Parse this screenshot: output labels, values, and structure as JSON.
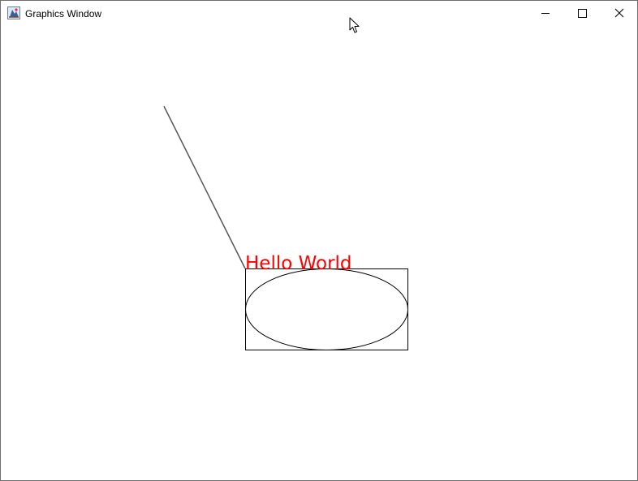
{
  "window": {
    "title": "Graphics Window",
    "app_icon": "java-app-icon",
    "controls": {
      "minimize_icon": "minimize-icon",
      "maximize_icon": "maximize-icon",
      "close_icon": "close-icon"
    }
  },
  "canvas": {
    "background": "#ffffff",
    "text": {
      "value": "Hello World",
      "color": "#ff0000"
    },
    "line": {
      "color": "#555555"
    },
    "rectangle": {
      "color": "#000000"
    },
    "ellipse": {
      "color": "#000000"
    }
  },
  "cursor": {
    "icon": "mouse-pointer-icon"
  }
}
